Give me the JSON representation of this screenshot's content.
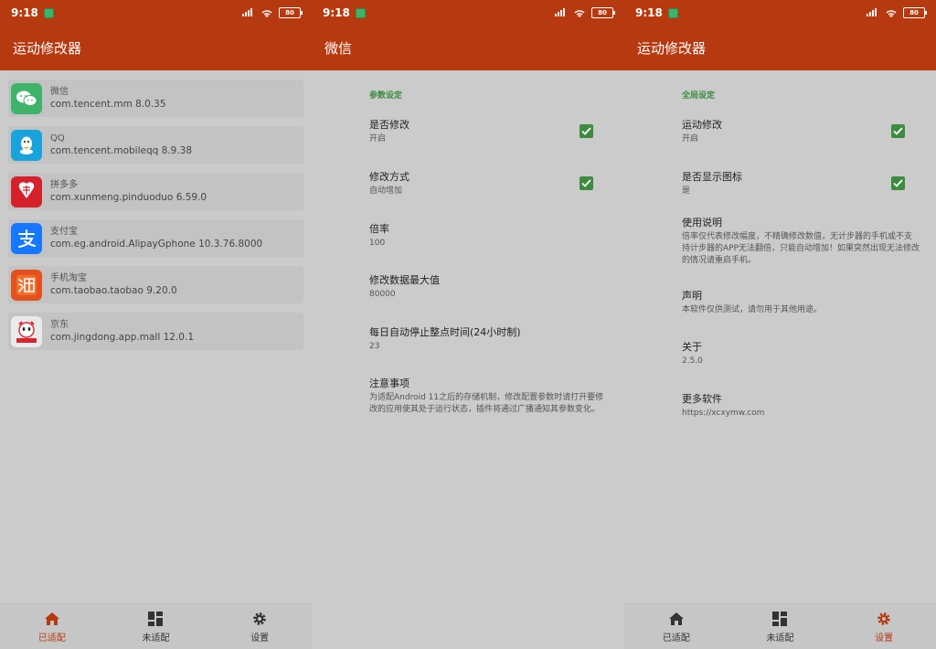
{
  "colors": {
    "accent": "#b7390f",
    "check": "#3d8b3f",
    "section": "#3b8a3e"
  },
  "status": {
    "time": "9:18",
    "signal": "HD",
    "battery": "80"
  },
  "screen1": {
    "title": "运动修改器",
    "apps": [
      {
        "name": "微信",
        "pkg": "com.tencent.mm 8.0.35",
        "icon": "wechat-icon"
      },
      {
        "name": "QQ",
        "pkg": "com.tencent.mobileqq 8.9.38",
        "icon": "qq-icon"
      },
      {
        "name": "拼多多",
        "pkg": "com.xunmeng.pinduoduo 6.59.0",
        "icon": "pinduoduo-icon"
      },
      {
        "name": "支付宝",
        "pkg": "com.eg.android.AlipayGphone 10.3.76.8000",
        "icon": "alipay-icon"
      },
      {
        "name": "手机淘宝",
        "pkg": "com.taobao.taobao 9.20.0",
        "icon": "taobao-icon"
      },
      {
        "name": "京东",
        "pkg": "com.jingdong.app.mall 12.0.1",
        "icon": "jd-icon"
      }
    ],
    "nav": [
      "已适配",
      "未适配",
      "设置"
    ]
  },
  "screen2": {
    "title": "微信",
    "section": "参数设定",
    "settings": [
      {
        "title": "是否修改",
        "summary": "开启"
      },
      {
        "title": "修改方式",
        "summary": "自动增加"
      },
      {
        "title": "倍率",
        "summary": "100"
      },
      {
        "title": "修改数据最大值",
        "summary": "80000"
      },
      {
        "title": "每日自动停止整点时间(24小时制)",
        "summary": "23"
      },
      {
        "title": "注意事项",
        "summary": "为适配Android 11之后的存储机制，修改配置参数时请打开要修改的应用使其处于运行状态，插件将通过广播通知其参数变化。"
      }
    ]
  },
  "screen3": {
    "title": "运动修改器",
    "section": "全局设定",
    "settings": [
      {
        "title": "运动修改",
        "summary": "开启"
      },
      {
        "title": "是否显示图标",
        "summary": "是"
      },
      {
        "title": "使用说明",
        "summary": "倍率仅代表修改幅度，不精确修改数值，无计步器的手机或不支持计步器的APP无法翻倍，只能自动增加！如果突然出现无法修改的情况请重启手机。"
      },
      {
        "title": "声明",
        "summary": "本软件仅供测试，请勿用于其他用途。"
      },
      {
        "title": "关于",
        "summary": "2.5.0"
      },
      {
        "title": "更多软件",
        "summary": "https://xcxymw.com"
      }
    ],
    "nav": [
      "已适配",
      "未适配",
      "设置"
    ]
  }
}
